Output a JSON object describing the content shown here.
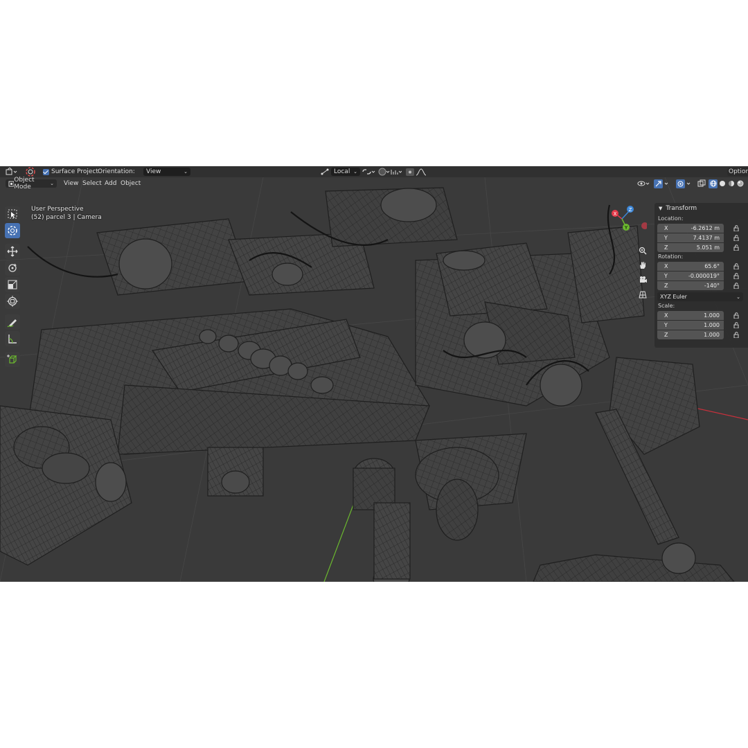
{
  "tool_header": {
    "tool_icon": "cursor-tool-icon",
    "surface_project_label": "Surface Project",
    "surface_project_checked": true,
    "orientation_label": "Orientation:",
    "orientation_value": "View",
    "transform_pivot": "Local",
    "options_label": "Options"
  },
  "viewport_header": {
    "mode": "Object Mode",
    "menus": [
      "View",
      "Select",
      "Add",
      "Object"
    ]
  },
  "viewport_overlay": {
    "perspective": "User Perspective",
    "object_info": "(52) parcel 3 | Camera"
  },
  "gizmo_axes": {
    "x": "X",
    "y": "Y",
    "z": "Z"
  },
  "toolbar": {
    "tools": [
      {
        "name": "select-box-tool",
        "active": false
      },
      {
        "name": "cursor-tool",
        "active": true
      },
      {
        "name": "move-tool",
        "active": false
      },
      {
        "name": "rotate-tool",
        "active": false
      },
      {
        "name": "scale-tool",
        "active": false
      },
      {
        "name": "transform-tool",
        "active": false
      },
      {
        "name": "annotate-tool",
        "active": false
      },
      {
        "name": "measure-tool",
        "active": false
      },
      {
        "name": "add-cube-tool",
        "active": false
      }
    ]
  },
  "npanel": {
    "title": "Transform",
    "location_label": "Location:",
    "location": [
      {
        "axis": "X",
        "value": "-6.2612 m"
      },
      {
        "axis": "Y",
        "value": "7.4137 m"
      },
      {
        "axis": "Z",
        "value": "5.051 m"
      }
    ],
    "rotation_label": "Rotation:",
    "rotation": [
      {
        "axis": "X",
        "value": "65.6°"
      },
      {
        "axis": "Y",
        "value": "-0.000019°"
      },
      {
        "axis": "Z",
        "value": "-140°"
      }
    ],
    "rotation_mode": "XYZ Euler",
    "scale_label": "Scale:",
    "scale": [
      {
        "axis": "X",
        "value": "1.000"
      },
      {
        "axis": "Y",
        "value": "1.000"
      },
      {
        "axis": "Z",
        "value": "1.000"
      }
    ]
  },
  "colors": {
    "accent": "#4772b3",
    "axis_x": "#e43a4a",
    "axis_y": "#6bb82f",
    "axis_z": "#3d87d8",
    "viewport_bg": "#3a3a3a"
  }
}
